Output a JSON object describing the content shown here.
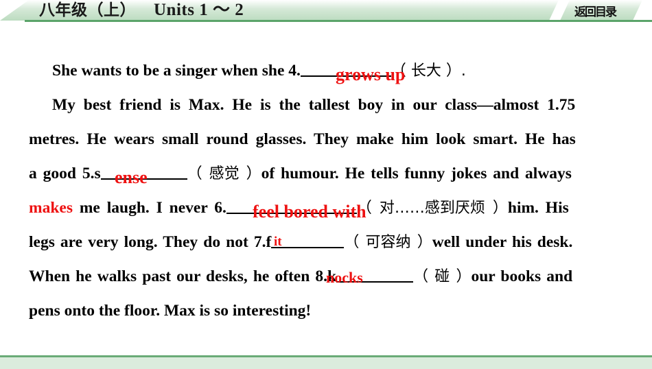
{
  "header": {
    "grade": "八年级",
    "volume": "（上）",
    "units": "Units 1 ～ 2",
    "return_label": "返回目录"
  },
  "passage": {
    "lines": [
      {
        "id": "line1",
        "segments": [
          {
            "text": "She wants to be a singer when she 4."
          },
          {
            "text": "__________",
            "type": "blank"
          },
          {
            "text": "（ 长大 ）.",
            "type": "cn"
          }
        ],
        "plain": "She wants to be a singer when she 4.__________（ 长大 ）."
      },
      {
        "id": "line2",
        "plain": "My best friend is Max. He is the tallest boy in our class—almost 1.75"
      },
      {
        "id": "line3",
        "plain": "metres. He wears small round glasses. They make him look smart. He has"
      },
      {
        "id": "line4",
        "plain": "a good 5.s__________（ 感觉 ）of humour. He tells funny jokes and always"
      },
      {
        "id": "line5",
        "plain": "makes me laugh. I never 6.______________（ 对……感到厌烦 ）him. His"
      },
      {
        "id": "line6",
        "plain": "legs are very long. They do not 7.f________（ 可容纳 ）well under his desk."
      },
      {
        "id": "line7",
        "plain": "When he walks past our desks, he often 8.k________（ 碰 ）our books and"
      },
      {
        "id": "line8",
        "plain": "pens onto the floor. Max is so interesting!"
      }
    ],
    "text_parts": {
      "l1_a": "She wants to be a singer when she 4.",
      "l1_cn": "（ 长大 ）.",
      "l2": "My best friend is Max. He is the tallest boy in our class—almost 1.75",
      "l3": "metres. He wears small round glasses. They make him look smart. He has",
      "l4_a": "a good 5.s",
      "l4_cn": "（ 感觉 ）",
      "l4_b": "of humour. He tells funny jokes and always",
      "l5_red": "makes",
      "l5_a": "me laugh. I never 6.",
      "l5_cn": "（ 对……感到厌烦 ）",
      "l5_b": "him. His",
      "l6_a": "legs are very long. They do not 7.f",
      "l6_cn": "（ 可容纳 ）",
      "l6_b": "well under his desk.",
      "l7_a": "When he walks past our desks, he often 8.k",
      "l7_cn": "（ 碰 ）",
      "l7_b": "our books and",
      "l8": "pens onto the floor. Max is so interesting!"
    }
  },
  "answers": {
    "a4": "grows up",
    "a5": "ense",
    "a6": "feel bored with",
    "a7": "it",
    "a8": "nocks"
  },
  "colors": {
    "answer_red": "#ee1111",
    "header_green": "#bcdcc0",
    "rule_green": "#5ba46a",
    "footer_green": "#dbecdd",
    "text_black": "#000000"
  }
}
